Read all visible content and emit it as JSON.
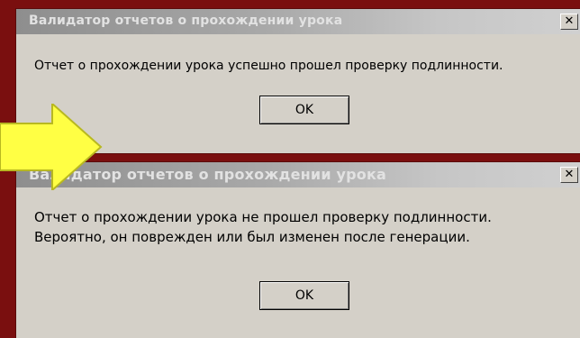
{
  "dialog_success": {
    "title": "Валидатор отчетов о прохождении урока",
    "close_glyph": "✕",
    "message": "Отчет о прохождении урока успешно прошел проверку подлинности.",
    "ok_label": "OK"
  },
  "dialog_failure": {
    "title": "Валидатор отчетов о прохождении урока",
    "close_glyph": "✕",
    "message_line1": "Отчет о прохождении урока не прошел проверку подлинности.",
    "message_line2": "Вероятно, он поврежден или был изменен после генерации.",
    "ok_label": "OK"
  },
  "colors": {
    "background": "#7a0f0f",
    "dialog": "#d4d0c8",
    "arrow_fill": "#ffff44",
    "arrow_stroke": "#b8b820"
  },
  "icons": [
    "close-icon",
    "arrow-right-icon"
  ]
}
